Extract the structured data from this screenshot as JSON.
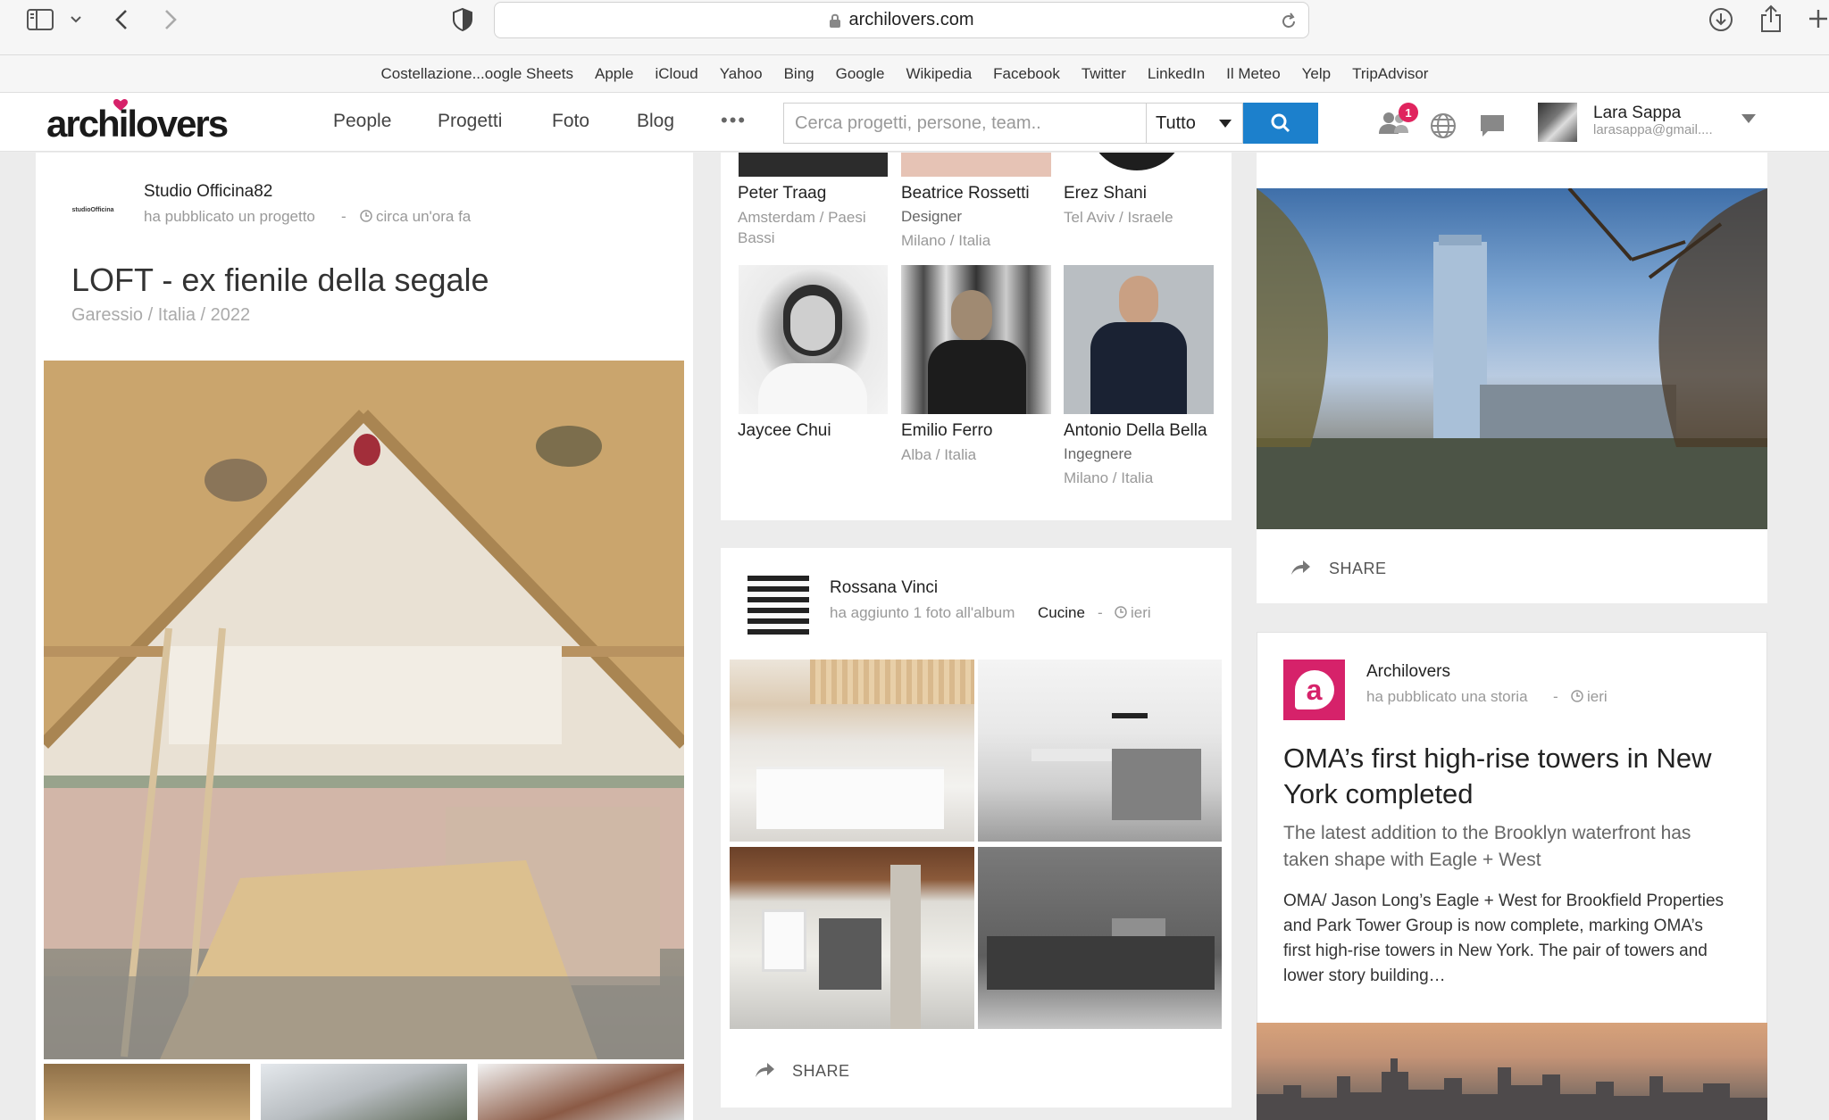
{
  "browser": {
    "url": "archilovers.com",
    "favorites": [
      "Costellazione...oogle Sheets",
      "Apple",
      "iCloud",
      "Yahoo",
      "Bing",
      "Google",
      "Wikipedia",
      "Facebook",
      "Twitter",
      "LinkedIn",
      "Il Meteo",
      "Yelp",
      "TripAdvisor"
    ]
  },
  "header": {
    "logo": "archilovers",
    "nav": [
      "People",
      "Progetti",
      "Foto",
      "Blog"
    ],
    "more": "•••",
    "search_placeholder": "Cerca progetti, persone, team..",
    "select_value": "Tutto",
    "notification_count": "1",
    "user_name": "Lara Sappa",
    "user_email": "larasappa@gmail...."
  },
  "project_card": {
    "author": "Studio Officina82",
    "action": "ha pubblicato un progetto",
    "time": "circa un'ora fa",
    "title": "LOFT - ex fienile della segale",
    "meta": "Garessio / Italia / 2022",
    "avatar_text": "studioOfficina"
  },
  "people_card": {
    "people": [
      {
        "name": "Peter Traag",
        "l1": "Amsterdam / Paesi",
        "l2": "Bassi",
        "l3": ""
      },
      {
        "name": "Beatrice Rossetti",
        "l1": "Designer",
        "l2": "Milano / Italia",
        "l3": ""
      },
      {
        "name": "Erez Shani",
        "l1": "Tel Aviv / Israele",
        "l2": "",
        "l3": ""
      },
      {
        "name": "Jaycee Chui",
        "l1": "",
        "l2": "",
        "l3": ""
      },
      {
        "name": "Emilio Ferro",
        "l1": "Alba / Italia",
        "l2": "",
        "l3": ""
      },
      {
        "name": "Antonio Della Bella",
        "l1": "Ingegnere",
        "l2": "Milano / Italia",
        "l3": ""
      }
    ]
  },
  "album_card": {
    "author": "Rossana Vinci",
    "action": "ha aggiunto 1 foto all'album",
    "album": "Cucine",
    "time": "ieri",
    "share": "SHARE"
  },
  "photo_card": {
    "share": "SHARE"
  },
  "story_card": {
    "author": "Archilovers",
    "action": "ha pubblicato una storia",
    "time": "ieri",
    "title": "OMA’s first high-rise towers in New York completed",
    "subtitle": "The latest addition to the Brooklyn waterfront has taken shape with Eagle + West",
    "body": "OMA/ Jason Long’s Eagle + West for Brookfield Properties and Park Tower Group is now complete, marking OMA’s first high-rise towers in New York. The pair of towers and lower story building…",
    "avatar_letter": "a"
  },
  "colors": {
    "accent": "#1c80cc",
    "brand_pink": "#d6226a",
    "badge": "#e0245e"
  }
}
